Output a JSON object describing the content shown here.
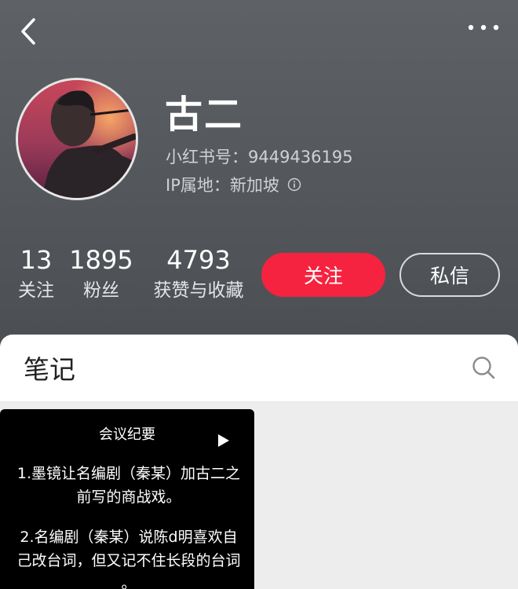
{
  "nav": {
    "back_icon": "chevron-left-icon",
    "more_icon": "more-horizontal-icon"
  },
  "profile": {
    "name": "古二",
    "account_id": "小红书号：9449436195",
    "ip_location": "IP属地：新加坡",
    "avatar_description": "profile photo"
  },
  "stats": [
    {
      "value": "13",
      "label": "关注"
    },
    {
      "value": "1895",
      "label": "粉丝"
    },
    {
      "value": "4793",
      "label": "获赞与收藏"
    }
  ],
  "actions": {
    "follow_label": "关注",
    "message_label": "私信"
  },
  "tabs": {
    "notes_label": "笔记",
    "search_icon": "search-icon"
  },
  "note_card": {
    "title": "会议纪要",
    "lines": [
      "1.墨镜让名编剧（秦某）加古二之",
      "前写的商战戏。",
      "",
      "2.名编剧（秦某）说陈d明喜欢自",
      "己改台词，但又记不住长段的台词",
      "。"
    ]
  },
  "colors": {
    "header_bg": "#575b5f",
    "follow_button": "#f5233f",
    "card_bg": "#000000"
  }
}
